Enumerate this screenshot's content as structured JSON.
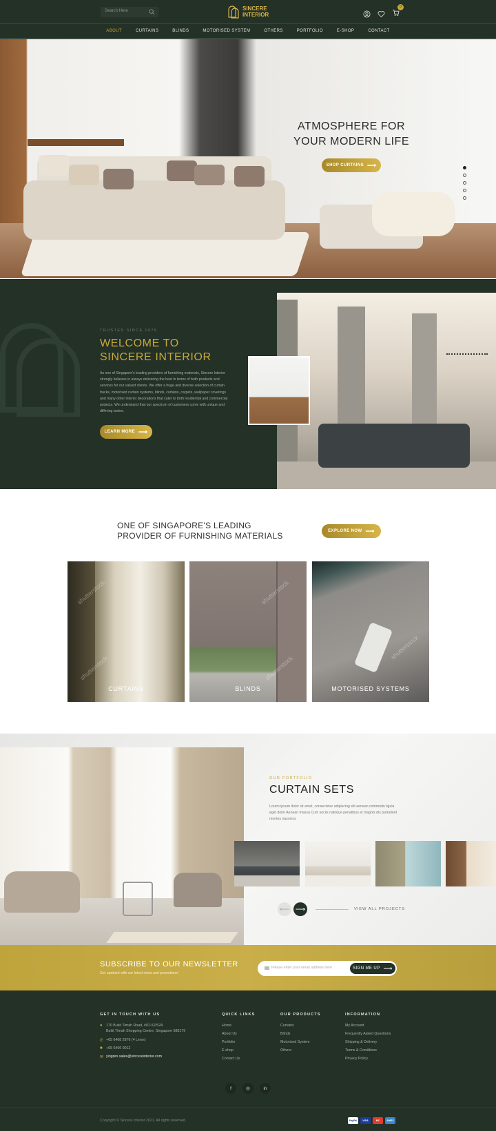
{
  "header": {
    "search_placeholder": "Search Here",
    "brand_line1": "SINCERE",
    "brand_line2": "INTERIOR",
    "cart_count": "0",
    "nav": [
      "ABOUT",
      "CURTAINS",
      "BLINDS",
      "MOTORISED SYSTEM",
      "OTHERS",
      "PORTFOLIO",
      "E-SHOP",
      "CONTACT"
    ],
    "nav_active": "ABOUT"
  },
  "hero": {
    "title_line1": "ATMOSPHERE FOR",
    "title_line2": "YOUR MODERN LIFE",
    "cta": "SHOP CURTAINS",
    "slide_count": 5,
    "active_slide": 1
  },
  "welcome": {
    "eyebrow": "TRUSTED SINCE 1976",
    "title_line1": "WELCOME TO",
    "title_line2": "SINCERE INTERIOR",
    "body": "As one of Singapore's leading providers of furnishing materials, Sincere Interior strongly believes in always delivering the best in terms of both products and services for our valued clients. We offer a huge and diverse selection of curtain tracks, motorised curtain systems, blinds, curtains, carpets, wallpaper coverings and many other interior decorations that cater to both residential and commercial projects. We understand that our spectrum of customers come with unique and differing tastes.",
    "cta": "LEARN MORE"
  },
  "leading": {
    "title_line1": "ONE OF SINGAPORE'S LEADING",
    "title_line2": "PROVIDER OF FURNISHING MATERIALS",
    "cta": "EXPLORE NOW",
    "cards": [
      {
        "label": "CURTAINS"
      },
      {
        "label": "BLINDS"
      },
      {
        "label": "MOTORISED SYSTEMS"
      }
    ],
    "watermark": "shutterstock"
  },
  "portfolio": {
    "eyebrow": "OUR PORTFOLIO",
    "title": "CURTAIN SETS",
    "body": "Lorem ipsum dolor sit amet, consectetur adipiscing elit aenean commodo ligula eget dolor Aenean massa Cum sociis natoque penatibus et magnis dis parturient montes nascetur.",
    "view_all": "VIEW ALL PROJECTS"
  },
  "newsletter": {
    "title": "SUBSCRIBE TO OUR NEWSLETTER",
    "subtitle": "Get updated with our latest news and promotions!",
    "placeholder": "Please enter your email address here",
    "button": "SIGN ME UP"
  },
  "footer": {
    "contact_title": "GET IN TOUCH WITH US",
    "address_line1": "170 Bukit Timah Road, #02-52/52A",
    "address_line2": "Bukit Timah Shopping Centre, Singapore 588179",
    "phone": "+65 6468 2876 (4 Lines)",
    "fax": "+65 6466 9012",
    "email": "yingren.sales@sincereinterior.com",
    "quick_title": "QUICK LINKS",
    "quick_links": [
      "Home",
      "About Us",
      "Portfolio",
      "E-shop",
      "Contact Us"
    ],
    "products_title": "OUR PRODUCTS",
    "products": [
      "Curtains",
      "Blinds",
      "Motorised System",
      "Others"
    ],
    "info_title": "INFORMATION",
    "info_links": [
      "My Account",
      "Frequently Asked Questions",
      "Shipping & Delivery",
      "Terms & Conditions",
      "Privacy Policy"
    ],
    "social": [
      "f",
      "◎",
      "in"
    ],
    "copyright": "Copyright © Sincere Interior 2021. All rights reserved.",
    "payments": [
      "PayPal",
      "VISA",
      "MC",
      "AMEX"
    ]
  },
  "colors": {
    "dark_green": "#233127",
    "gold": "#c8a839",
    "gold_light": "#d6b648"
  }
}
